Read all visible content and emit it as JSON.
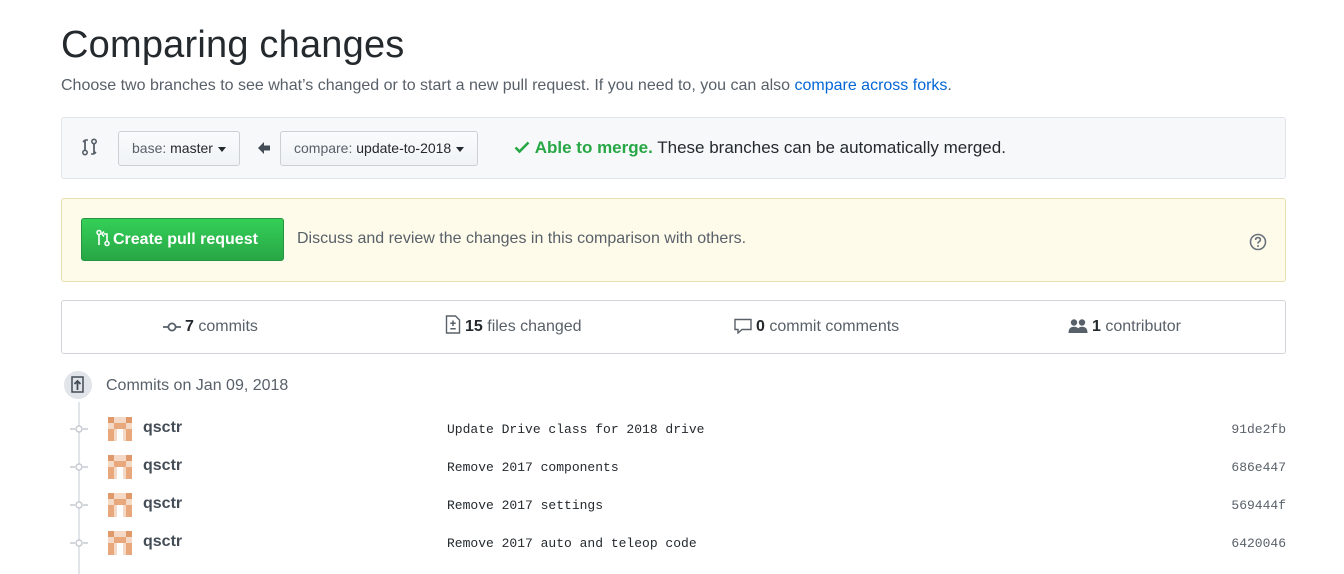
{
  "page": {
    "title": "Comparing changes",
    "subtitle_text": "Choose two branches to see what’s changed or to start a new pull request. If you need to, you can also ",
    "subtitle_link": "compare across forks",
    "subtitle_end": "."
  },
  "range": {
    "base_prefix": "base:",
    "base_branch": "master",
    "compare_prefix": "compare:",
    "compare_branch": "update-to-2018",
    "merge_status": "Able to merge.",
    "merge_detail": "These branches can be automatically merged."
  },
  "pr": {
    "button_label": "Create pull request",
    "description": "Discuss and review the changes in this comparison with others."
  },
  "summary": {
    "commits_count": "7",
    "commits_label": "commits",
    "files_count": "15",
    "files_label": "files changed",
    "comments_count": "0",
    "comments_label": "commit comments",
    "contributors_count": "1",
    "contributors_label": "contributor"
  },
  "commits": {
    "group_title": "Commits on Jan 09, 2018",
    "items": [
      {
        "author": "qsctr",
        "message": "Update Drive class for 2018 drive",
        "sha": "91de2fb"
      },
      {
        "author": "qsctr",
        "message": "Remove 2017 components",
        "sha": "686e447"
      },
      {
        "author": "qsctr",
        "message": "Remove 2017 settings",
        "sha": "569444f"
      },
      {
        "author": "qsctr",
        "message": "Remove 2017 auto and teleop code",
        "sha": "6420046"
      }
    ]
  },
  "colors": {
    "link": "#0366d6",
    "success": "#28a745",
    "banner_bg": "#fffbea",
    "avatar_main": "#e8a87c"
  },
  "icons": {
    "range": "git-compare-icon",
    "arrow": "arrow-left-icon",
    "check": "check-icon",
    "pull_request": "git-pull-request-icon",
    "help": "question-icon",
    "commit": "git-commit-icon",
    "file": "file-diff-icon",
    "comment": "comment-icon",
    "people": "organization-icon",
    "repo_push": "repo-push-icon"
  }
}
